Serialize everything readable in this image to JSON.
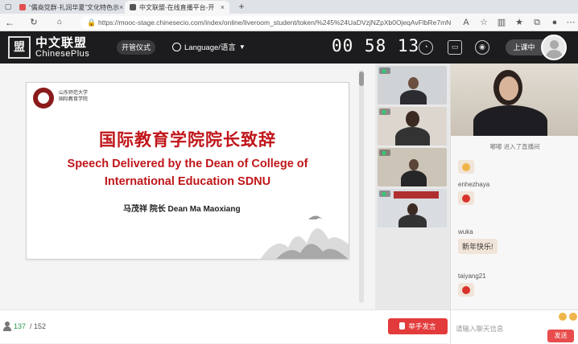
{
  "browser": {
    "tabs": [
      {
        "label": "“儒商党群·礼润华夏”文化特色示",
        "close": "×"
      },
      {
        "label": "中文联盟-在线直播平台-开",
        "close": "×"
      }
    ],
    "new_tab": "+",
    "url": "https://mooc-stage.chinesecio.com/index/online/liveroom_student/token/%245%24UaDVzjNZpXb0OjeqAvFlbRe7mNZAO6..."
  },
  "header": {
    "logo_mark": "盟",
    "logo_cn": "中文联盟",
    "logo_en": "ChinesePlus",
    "mute_label": "开管仪式",
    "language_label": "Language/语言",
    "timer": "00 58 13",
    "class_status": "上课中"
  },
  "slide": {
    "school_line1": "山东师范大学",
    "school_line2": "国际教育学院",
    "title_cn": "国际教育学院院长致辞",
    "title_en_line1": "Speech Delivered by the Dean of College of",
    "title_en_line2": "International Education SDNU",
    "speaker": "马茂祥 院长  Dean Ma Maoxiang"
  },
  "chat": {
    "system_message": "嘟嘟 进入了直播间",
    "messages": [
      {
        "user": "",
        "text": ""
      },
      {
        "user": "enhezhaya",
        "text": ""
      },
      {
        "user": "wuka",
        "text": "新年快乐!"
      },
      {
        "user": "taiyang21",
        "text": ""
      }
    ],
    "input_placeholder": "请输入聊天信息",
    "send_label": "发送"
  },
  "bottom": {
    "online_count": "137",
    "total_count": "/ 152",
    "raise_hand_label": "举手发言"
  },
  "colors": {
    "header_bg": "#1c1c1e",
    "slide_red": "#c0161a",
    "raise_hand_red": "#e33b3b",
    "online_green": "#2a9a4a"
  }
}
